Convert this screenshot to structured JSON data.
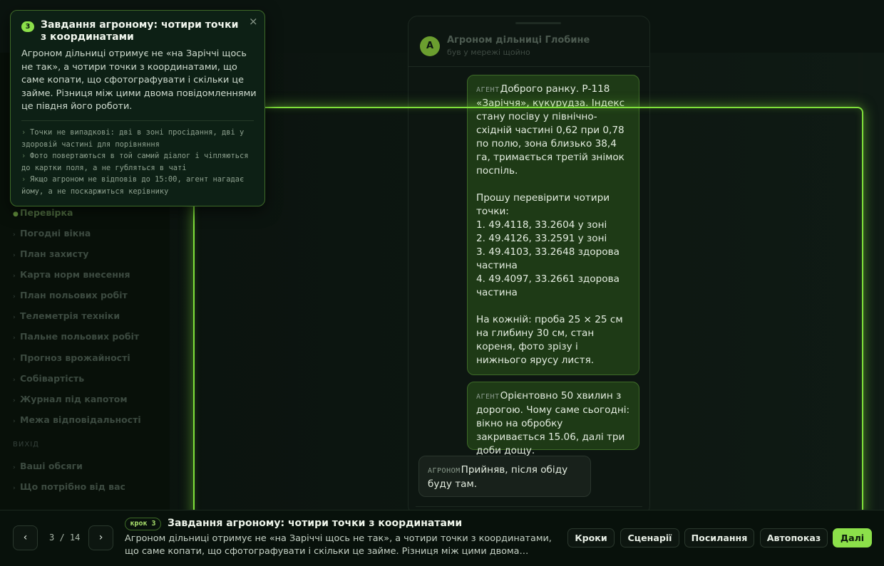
{
  "sidebar": {
    "items": [
      {
        "label": "Перевіркa",
        "active": true
      },
      {
        "label": "Погодні вікна"
      },
      {
        "label": "План захисту"
      },
      {
        "label": "Карта норм внесення"
      },
      {
        "label": "План польових робіт"
      },
      {
        "label": "Телеметрія техніки"
      },
      {
        "label": "Пальне польових робіт"
      },
      {
        "label": "Прогноз врожайності"
      },
      {
        "label": "Собівартість"
      },
      {
        "label": "Журнал під капотом"
      },
      {
        "label": "Межа відповідальності"
      }
    ],
    "section_label": "ВИХІД",
    "section_items": [
      {
        "label": "Ваші обсяги"
      },
      {
        "label": "Що потрібно від вас"
      }
    ]
  },
  "chat": {
    "avatar_letter": "А",
    "contact_name": "Агроном дільниці Глобине",
    "contact_status": "був у мережі щойно",
    "messages": [
      {
        "role": "agent",
        "tag": "АГЕНТ",
        "text": "Доброго ранку. Р-118 «Заріччя», кукурудза. Індекс стану посіву у північно-східній частині 0,62 при 0,78 по полю, зона близько 38,4 га, тримається третій знімок поспіль.\n\nПрошу перевірити чотири точки:\n1. 49.4118, 33.2604 у зоні\n2. 49.4126, 33.2591 у зоні\n3. 49.4103, 33.2648 здорова частина\n4. 49.4097, 33.2661 здорова частина\n\nНа кожній: проба 25 × 25 см на глибину 30 см, стан кореня, фото зрізу і нижнього ярусу листя."
      },
      {
        "role": "agent",
        "tag": "АГЕНТ",
        "text": "Орієнтовно 50 хвилин з дорогою. Чому саме сьогодні: вікно на обробку закривається 15.06, далі три доби дощу."
      },
      {
        "role": "user",
        "tag": "АГРОНОМ",
        "text": "Прийняв, після обіду буду там."
      }
    ]
  },
  "tooltip": {
    "number": "3",
    "title": "Завдання агроному: чотири точки з координатами",
    "close_glyph": "×",
    "body": "Агроном дільниці отримує не «на Заріччі щось не так», а чотири точки з координатами, що саме копати, що сфотографувати і скільки це займе. Різниця між цими двома повідомленнями це півдня його роботи.",
    "points": [
      "Точки не випадкові: дві в зоні просідання, дві у здоровій частині для порівняння",
      "Фото повертаються в той самий діалог і чіпляються до картки поля, а не губляться в чаті",
      "Якщо агроном не відповів до 15:00, агент нагадає йому, а не поскаржиться керівнику"
    ]
  },
  "bottom": {
    "prev_glyph": "‹",
    "next_glyph": "›",
    "counter": "3 / 14",
    "step_badge": "крок 3",
    "title": "Завдання агроному: чотири точки з координатами",
    "description": "Агроном дільниці отримує не «на Заріччі щось не так», а чотири точки з координатами, що саме копати, що сфотографувати і скільки це займе. Різниця між цими двома…",
    "buttons": {
      "steps": "Кроки",
      "scenarios": "Сценарії",
      "links": "Посилання",
      "autoplay": "Автопоказ",
      "next": "Далі"
    }
  },
  "colors": {
    "accent": "#8ce04a",
    "spotlight_border": "#7fe03a",
    "agent_bubble": "#1e3a16",
    "user_bubble": "#18211b",
    "background": "#07100b"
  },
  "icons": {
    "chevron_right": "chevron-right-icon",
    "close": "close-icon",
    "prev": "chevron-left-icon",
    "next": "chevron-right-icon"
  }
}
